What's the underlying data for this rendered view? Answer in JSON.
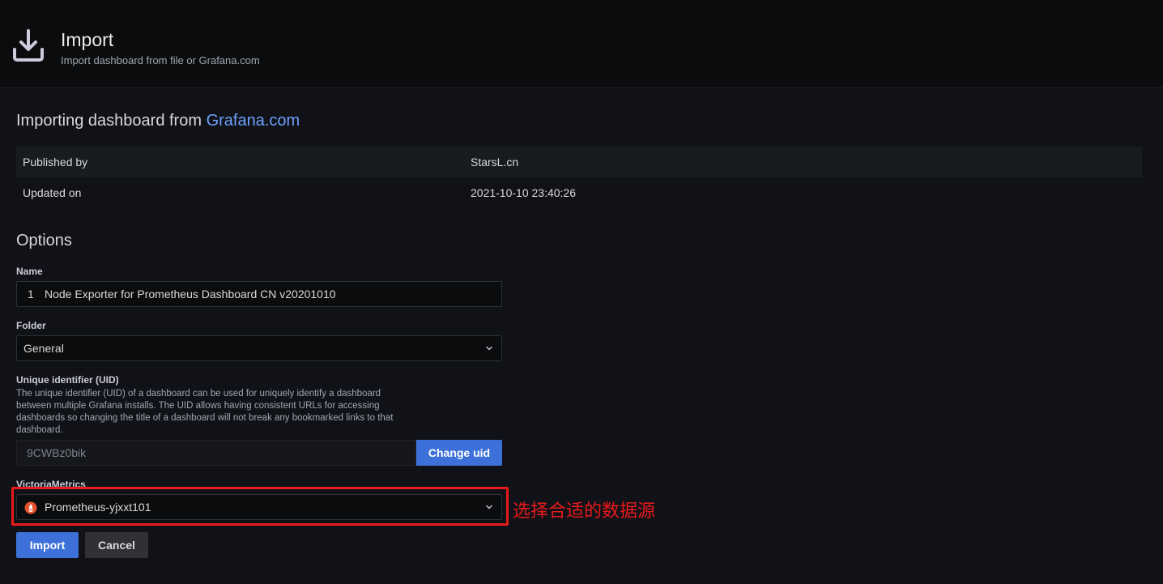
{
  "header": {
    "icon": "download-icon",
    "title": "Import",
    "subtitle": "Import dashboard from file or Grafana.com"
  },
  "importing": {
    "prefix": "Importing dashboard from ",
    "link_text": "Grafana.com",
    "link_color": "#6e9fff"
  },
  "info": {
    "published_label": "Published by",
    "published_value": "StarsL.cn",
    "updated_label": "Updated on",
    "updated_value": "2021-10-10 23:40:26"
  },
  "options": {
    "title": "Options",
    "name_label": "Name",
    "name_prefix": "1",
    "name_value": "Node Exporter for Prometheus Dashboard CN v20201010",
    "folder_label": "Folder",
    "folder_value": "General",
    "uid_label": "Unique identifier (UID)",
    "uid_description": "The unique identifier (UID) of a dashboard can be used for uniquely identify a dashboard between multiple Grafana installs. The UID allows having consistent URLs for accessing dashboards so changing the title of a dashboard will not break any bookmarked links to that dashboard.",
    "uid_value": "9CWBz0bik",
    "change_uid_label": "Change uid",
    "datasource_label": "VictoriaMetrics",
    "datasource_icon": "prometheus-icon",
    "datasource_value": "Prometheus-yjxxt101"
  },
  "annotation": {
    "text": "选择合适的数据源",
    "color": "#e8191c"
  },
  "actions": {
    "import_label": "Import",
    "cancel_label": "Cancel"
  },
  "colors": {
    "primary": "#3d71d9",
    "background": "#111217"
  }
}
